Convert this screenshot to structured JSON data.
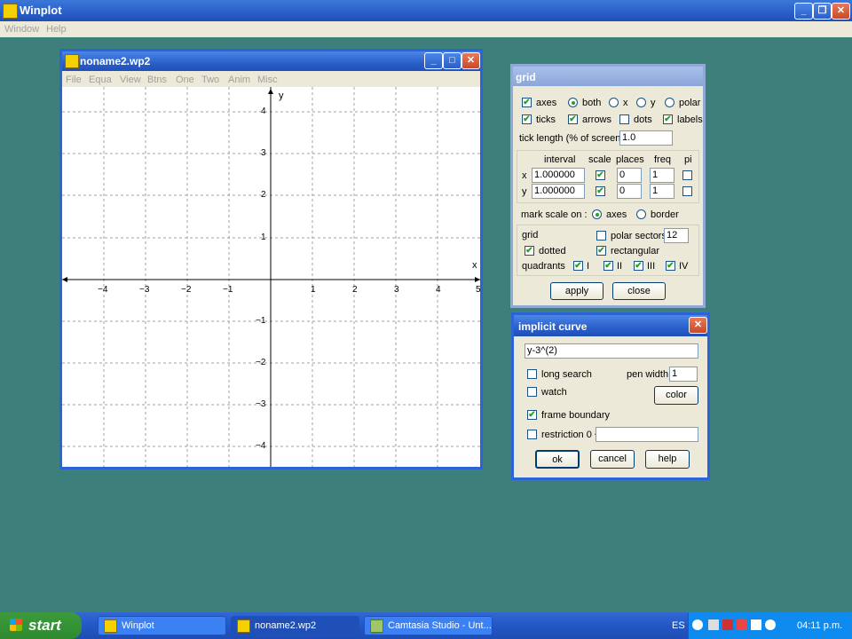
{
  "app": {
    "title": "Winplot",
    "menu": [
      "Window",
      "Help"
    ]
  },
  "graph_window": {
    "title": "noname2.wp2",
    "menu": [
      "File",
      "Equa",
      "View",
      "Btns",
      "One",
      "Two",
      "Anim",
      "Misc"
    ],
    "axis_x_label": "x",
    "axis_y_label": "y",
    "x_ticks": [
      "−4",
      "−3",
      "−2",
      "−1",
      "1",
      "2",
      "3",
      "4",
      "5"
    ],
    "y_ticks": [
      "4",
      "3",
      "2",
      "1",
      "−1",
      "−2",
      "−3",
      "−4"
    ]
  },
  "grid_dialog": {
    "title": "grid",
    "axes_label": "axes",
    "axes_checked": true,
    "both": "both",
    "x": "x",
    "y": "y",
    "polar": "polar",
    "axes_selected": "both",
    "ticks": "ticks",
    "arrows": "arrows",
    "dots": "dots",
    "labels": "labels",
    "tick_length_label": "tick length (% of screen)",
    "tick_length": "1.0",
    "col_interval": "interval",
    "col_scale": "scale",
    "col_places": "places",
    "col_freq": "freq",
    "col_pi": "pi",
    "row_x": {
      "label": "x",
      "interval": "1.000000",
      "places": "0",
      "freq": "1"
    },
    "row_y": {
      "label": "y",
      "interval": "1.000000",
      "places": "0",
      "freq": "1"
    },
    "mark_scale_label": "mark scale on :",
    "mark_axes": "axes",
    "mark_border": "border",
    "grid_label": "grid",
    "polar_sectors_label": "polar sectors",
    "polar_sectors": "12",
    "dotted": "dotted",
    "rectangular": "rectangular",
    "quadrants": "quadrants",
    "q": [
      "I",
      "II",
      "III",
      "IV"
    ],
    "apply": "apply",
    "close": "close"
  },
  "implicit_dialog": {
    "title": "implicit curve",
    "equation": "y-3^(2)",
    "long_search": "long search",
    "pen_width_label": "pen width",
    "pen_width": "1",
    "watch": "watch",
    "color": "color",
    "frame_boundary": "frame boundary",
    "restriction": "restriction 0 <",
    "ok": "ok",
    "cancel": "cancel",
    "help": "help"
  },
  "taskbar": {
    "start": "start",
    "tasks": [
      "Winplot",
      "noname2.wp2",
      "Camtasia Studio - Unt..."
    ],
    "lang": "ES",
    "clock": "04:11 p.m."
  }
}
